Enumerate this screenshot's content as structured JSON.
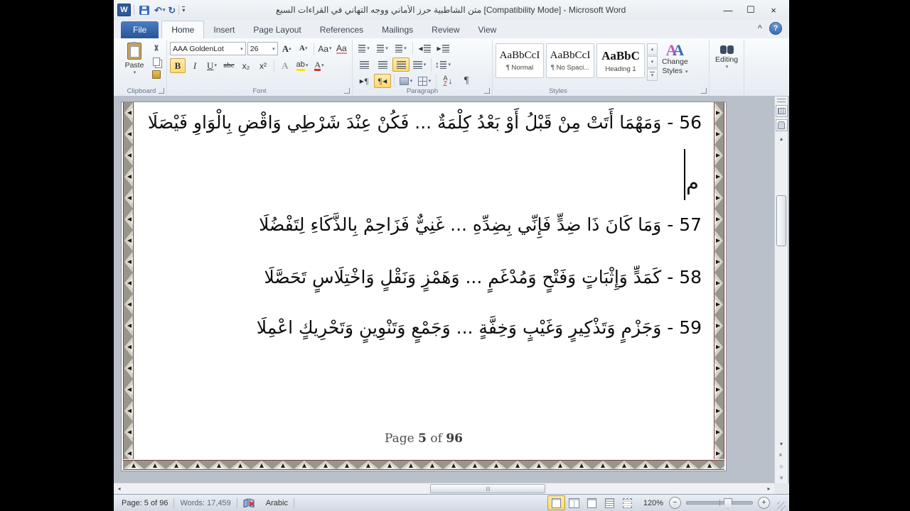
{
  "window": {
    "title": "متن الشاطبية حرز الأماني ووجه التهاني في القراءات السبع [Compatibility Mode] - Microsoft Word"
  },
  "icons": {
    "dropdown": "▾",
    "undo": "↶",
    "redo": "↻",
    "minimize": "—",
    "maximize": "☐",
    "close": "×",
    "collapse_ribbon": "^",
    "help": "?",
    "up": "▴",
    "down": "▾",
    "left": "◂",
    "right": "▸",
    "double_chevron": "«",
    "circle": "○",
    "minus": "−",
    "plus": "+",
    "updown": "↕",
    "pilcrow": "¶",
    "sort_a": "A",
    "sort_arrow": "↓"
  },
  "ribbon": {
    "tabs": [
      {
        "label": "File"
      },
      {
        "label": "Home"
      },
      {
        "label": "Insert"
      },
      {
        "label": "Page Layout"
      },
      {
        "label": "References"
      },
      {
        "label": "Mailings"
      },
      {
        "label": "Review"
      },
      {
        "label": "View"
      }
    ],
    "clipboard": {
      "group_label": "Clipboard",
      "paste": "Paste"
    },
    "font": {
      "group_label": "Font",
      "font_name": "AAA GoldenLot",
      "font_size": "26",
      "grow": "A",
      "shrink": "A",
      "change_case": "Aa",
      "clear_formatting": "Aa",
      "bold": "B",
      "italic": "I",
      "underline": "U",
      "strikethrough": "abc",
      "subscript": "x₂",
      "superscript": "x²",
      "text_effects": "A",
      "highlight": "ab",
      "font_color": "A"
    },
    "paragraph": {
      "group_label": "Paragraph"
    },
    "styles": {
      "group_label": "Styles",
      "items": [
        {
          "preview": "AaBbCcI",
          "name": "¶ Normal"
        },
        {
          "preview": "AaBbCcI",
          "name": "¶ No Spaci..."
        },
        {
          "preview": "AaBbC",
          "name": "Heading 1"
        }
      ],
      "change_styles_line1": "Change",
      "change_styles_line2": "Styles",
      "editing": "Editing"
    }
  },
  "document": {
    "verses": [
      {
        "text": "56 - وَمَهْمَا أَتَتْ مِنْ قَبْلُ أَوْ بَعْدُ كِلْمَةٌ ... فَكُنْ عِنْدَ شَرْطِي وَاقْضِ بِالْوَاوِ فَيْصَلَا"
      },
      {
        "text": "57 - وَمَا كَانَ ذَا ضِدٍّ فَإِنِّي بِضِدِّهِ ... غَنِيٌّ فَزَاحِمْ بِالذَّكَاءِ لِتَفْضُلَا"
      },
      {
        "text": "58 - كَمَدٍّ وَإِثْبَاتٍ وَفَتْحٍ وَمُدْغَمٍ ... وَهَمْزٍ وَنَقْلٍ وَاخْتِلَاسٍ تَحَصَّلَا"
      },
      {
        "text": "59 - وَجَزْمٍ وَتَذْكِيرٍ وَغَيْبٍ وَخِفَّةٍ ... وَجَمْعٍ وَتَنْوِينٍ وَتَحْرِيكٍ اعْمِلَا"
      }
    ],
    "typed_char": "م",
    "footer": {
      "prefix": "Page",
      "page": "5",
      "of": "of",
      "total": "96"
    }
  },
  "status_bar": {
    "page": "Page: 5 of 96",
    "words": "Words: 17,459",
    "language": "Arabic",
    "zoom_level": "120%"
  },
  "colors": {
    "file_tab_blue": "#2b5797",
    "toggle_highlight": "#fcd96f",
    "border_maroon": "#7c4444"
  }
}
